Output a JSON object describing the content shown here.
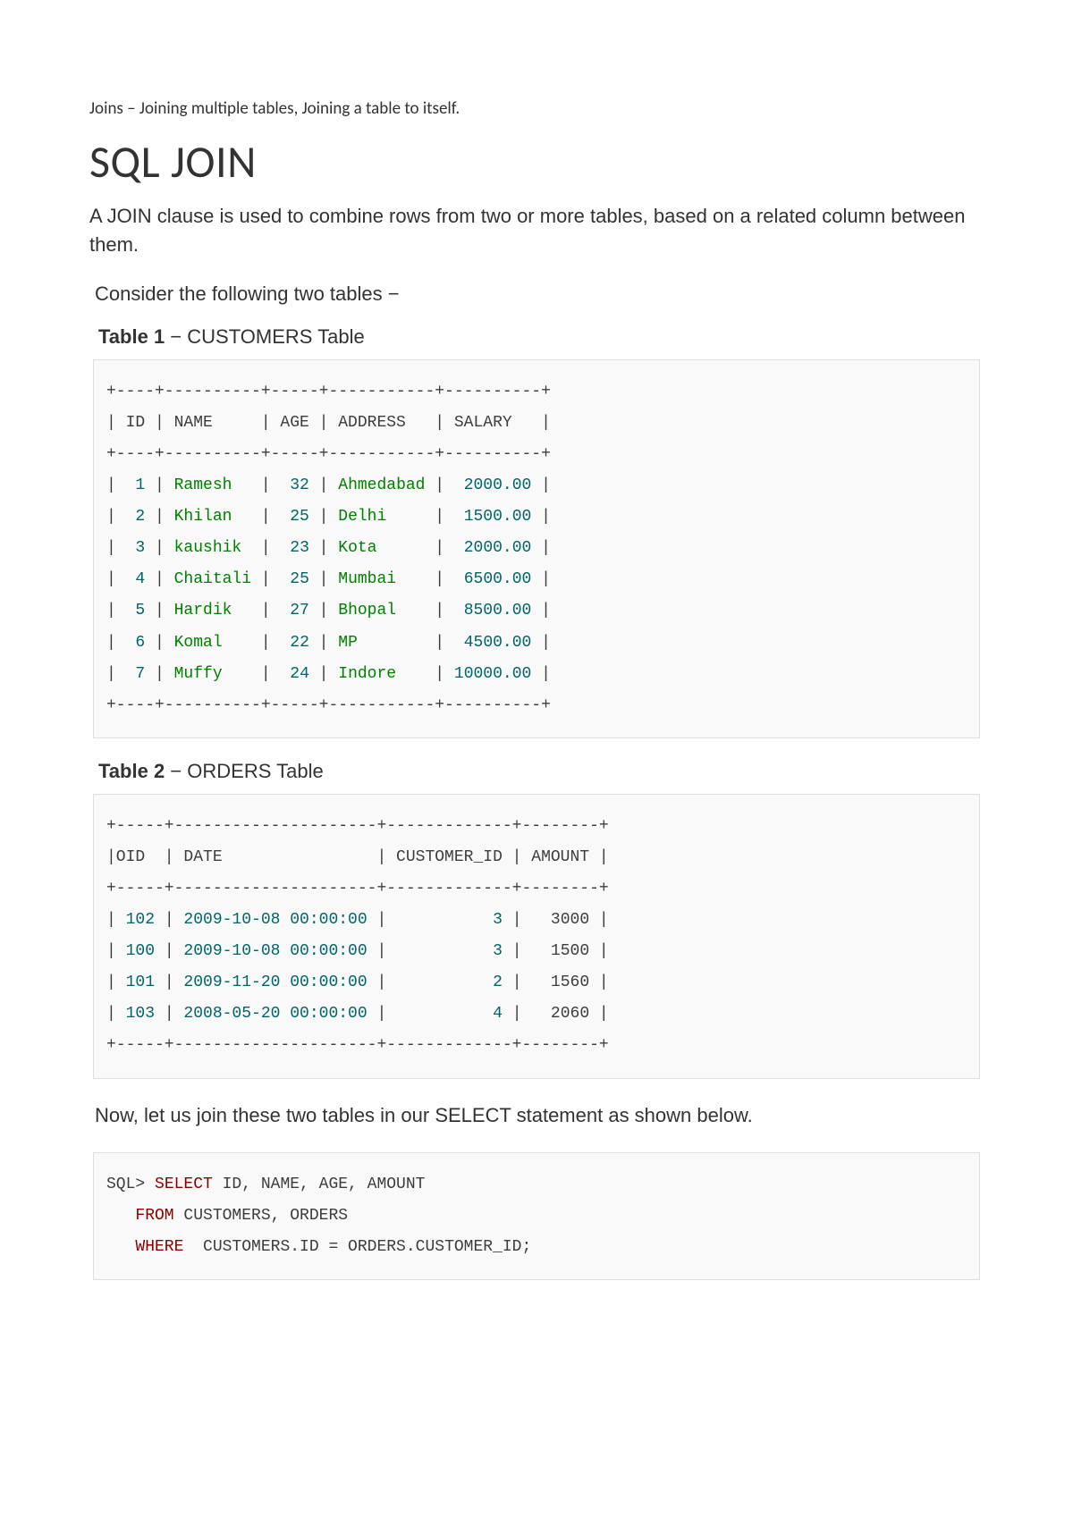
{
  "pretext": "Joins – Joining multiple tables, Joining a table to itself.",
  "title": "SQL JOIN",
  "intro": "A JOIN clause is used to combine rows from two or more tables, based on a related column between them.",
  "consider": "Consider the following two tables −",
  "table1": {
    "caption_bold": "Table 1",
    "caption_rest": " − CUSTOMERS Table",
    "columns": [
      "ID",
      "NAME",
      "AGE",
      "ADDRESS",
      "SALARY"
    ],
    "rows": [
      {
        "id": 1,
        "name": "Ramesh",
        "age": 32,
        "address": "Ahmedabad",
        "salary": "2000.00"
      },
      {
        "id": 2,
        "name": "Khilan",
        "age": 25,
        "address": "Delhi",
        "salary": "1500.00"
      },
      {
        "id": 3,
        "name": "kaushik",
        "age": 23,
        "address": "Kota",
        "salary": "2000.00"
      },
      {
        "id": 4,
        "name": "Chaitali",
        "age": 25,
        "address": "Mumbai",
        "salary": "6500.00"
      },
      {
        "id": 5,
        "name": "Hardik",
        "age": 27,
        "address": "Bhopal",
        "salary": "8500.00"
      },
      {
        "id": 6,
        "name": "Komal",
        "age": 22,
        "address": "MP",
        "salary": "4500.00"
      },
      {
        "id": 7,
        "name": "Muffy",
        "age": 24,
        "address": "Indore",
        "salary": "10000.00"
      }
    ]
  },
  "table2": {
    "caption_bold": "Table 2",
    "caption_rest": " − ORDERS Table",
    "columns": [
      "OID",
      "DATE",
      "CUSTOMER_ID",
      "AMOUNT"
    ],
    "rows": [
      {
        "oid": 102,
        "date": "2009-10-08 00:00:00",
        "customer_id": 3,
        "amount": 3000
      },
      {
        "oid": 100,
        "date": "2009-10-08 00:00:00",
        "customer_id": 3,
        "amount": 1500
      },
      {
        "oid": 101,
        "date": "2009-11-20 00:00:00",
        "customer_id": 2,
        "amount": 1560
      },
      {
        "oid": 103,
        "date": "2008-05-20 00:00:00",
        "customer_id": 4,
        "amount": 2060
      }
    ]
  },
  "nowjoin": "Now, let us join these two tables in our SELECT statement as shown below.",
  "sql": {
    "prompt": "SQL>",
    "kw_select": "SELECT",
    "cols": "ID, NAME, AGE, AMOUNT",
    "kw_from": "FROM",
    "tables": "CUSTOMERS, ORDERS",
    "kw_where": "WHERE",
    "cond": "CUSTOMERS.ID = ORDERS.CUSTOMER_ID;"
  }
}
